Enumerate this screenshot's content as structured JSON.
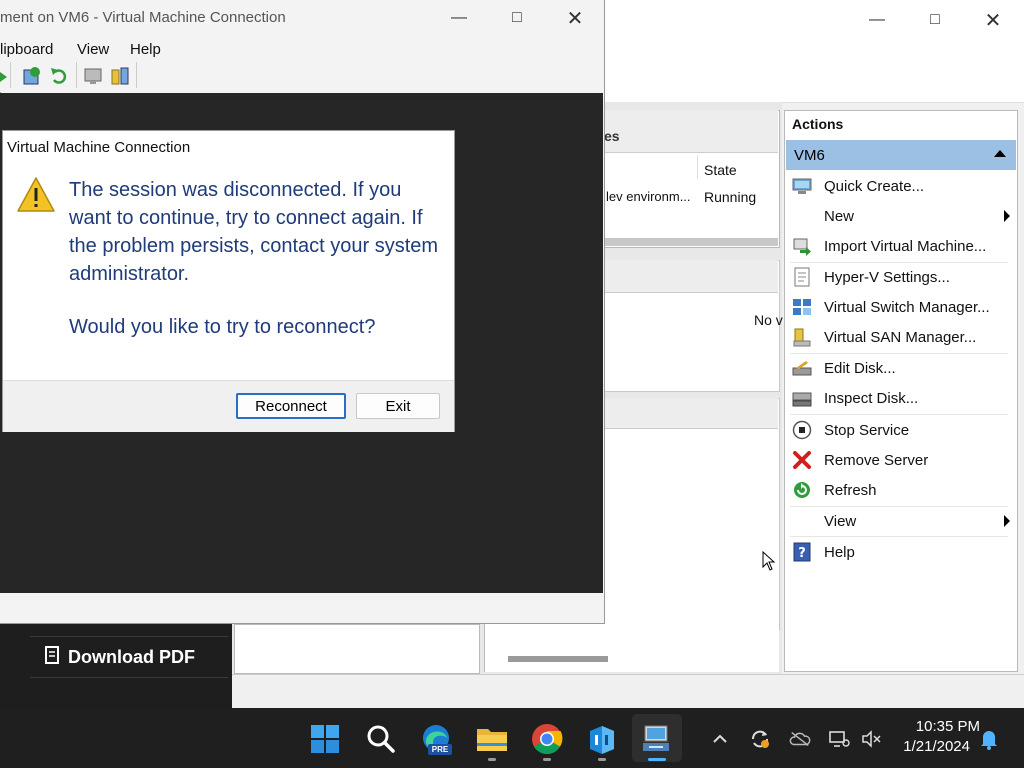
{
  "background_page": {
    "download_pdf_label": "Download PDF"
  },
  "hyperv_manager": {
    "vm_list_header": "es",
    "columns": {
      "state": "State"
    },
    "vm_row": {
      "name": "lev environm...",
      "state": "Running"
    },
    "detail_text": "No v",
    "actions": {
      "title": "Actions",
      "group_label": "VM6",
      "items": [
        {
          "label": "Quick Create...",
          "icon": "quick-create-icon",
          "submenu": false
        },
        {
          "label": "New",
          "icon": "",
          "submenu": true
        },
        {
          "label": "Import Virtual Machine...",
          "icon": "import-vm-icon",
          "submenu": false
        },
        {
          "label": "Hyper-V Settings...",
          "icon": "settings-page-icon",
          "submenu": false
        },
        {
          "label": "Virtual Switch Manager...",
          "icon": "switch-icon",
          "submenu": false
        },
        {
          "label": "Virtual SAN Manager...",
          "icon": "san-icon",
          "submenu": false
        },
        {
          "label": "Edit Disk...",
          "icon": "edit-disk-icon",
          "submenu": false
        },
        {
          "label": "Inspect Disk...",
          "icon": "inspect-disk-icon",
          "submenu": false
        },
        {
          "label": "Stop Service",
          "icon": "stop-icon",
          "submenu": false
        },
        {
          "label": "Remove Server",
          "icon": "remove-x-icon",
          "submenu": false
        },
        {
          "label": "Refresh",
          "icon": "refresh-icon",
          "submenu": false
        },
        {
          "label": "View",
          "icon": "",
          "submenu": true
        },
        {
          "label": "Help",
          "icon": "help-icon",
          "submenu": false
        }
      ]
    }
  },
  "vm_connection": {
    "title": "ment on VM6 - Virtual Machine Connection",
    "menu": [
      "lipboard",
      "View",
      "Help"
    ]
  },
  "dialog": {
    "title": "Virtual Machine Connection",
    "message": "The session was disconnected. If you want to continue, try to connect again. If the problem persists, contact your system administrator.",
    "question": "Would you like to try to reconnect?",
    "reconnect_label": "Reconnect",
    "exit_label": "Exit"
  },
  "taskbar": {
    "time": "10:35 PM",
    "date": "1/21/2024",
    "apps": [
      "start-icon",
      "search-icon",
      "edge-preview-icon",
      "file-explorer-icon",
      "chrome-icon",
      "server-app-icon",
      "hyperv-icon"
    ],
    "pre_badge": "PRE"
  },
  "colors": {
    "dialog_text": "#1f3b7a",
    "actions_highlight": "#9cbfe4",
    "taskbar": "#1f1f1f"
  }
}
